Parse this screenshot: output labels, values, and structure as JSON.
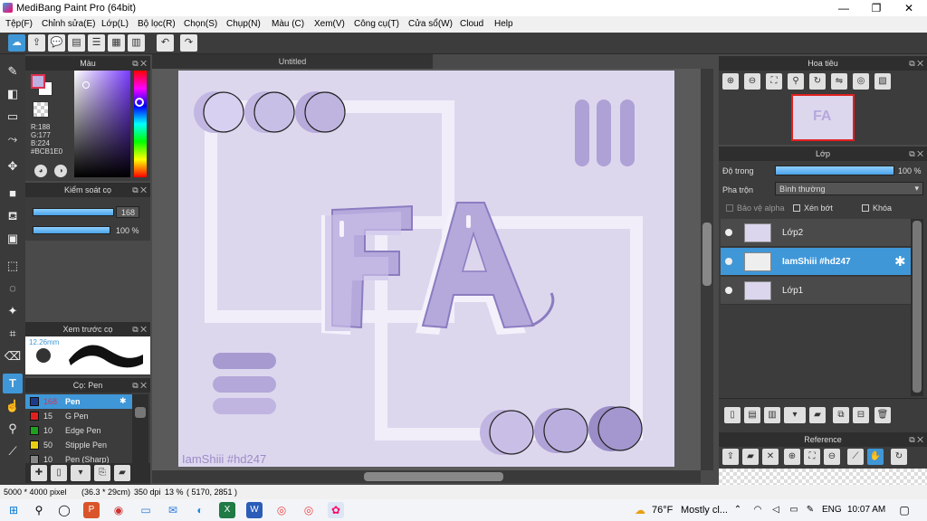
{
  "window": {
    "title": "MediBang Paint Pro (64bit)",
    "minimize": "—",
    "maximize": "❐",
    "close": "✕"
  },
  "menu": [
    "Tệp(F)",
    "Chỉnh sửa(E)",
    "Lớp(L)",
    "Bộ lọc(R)",
    "Chọn(S)",
    "Chụp(N)",
    "Màu (C)",
    "Xem(V)",
    "Công cụ(T)",
    "Cửa sổ(W)",
    "Cloud",
    "Help"
  ],
  "color_panel": {
    "title": "Màu",
    "r": "R:188",
    "g": "G:177",
    "b": "B:224",
    "hex": "#BCB1E0",
    "fg_color": "#bcb1e0"
  },
  "brush_control": {
    "title": "Kiểm soát cọ",
    "size_value": "168",
    "opacity_value": "100 %"
  },
  "brush_preview": {
    "title": "Xem trước cọ",
    "size_label": "12.26mm"
  },
  "brush_list": {
    "title": "Cọ: Pen",
    "items": [
      {
        "size": "168",
        "name": "Pen",
        "color": "#1e3a8a"
      },
      {
        "size": "15",
        "name": "G Pen",
        "color": "#e02020"
      },
      {
        "size": "10",
        "name": "Edge Pen",
        "color": "#20a020"
      },
      {
        "size": "50",
        "name": "Stipple Pen",
        "color": "#e8d010"
      },
      {
        "size": "10",
        "name": "Pen (Sharp)",
        "color": "#888888"
      }
    ]
  },
  "canvas": {
    "tab_title": "Untitled",
    "watermark": "IamShiii #hd247",
    "art_text": "FA"
  },
  "navigator": {
    "title": "Hoa tiêu"
  },
  "layers": {
    "title": "Lớp",
    "opacity_label": "Độ trong",
    "opacity_value": "100 %",
    "blend_label": "Pha trộn",
    "blend_value": "Bình thường",
    "protect_alpha": "Bảo vệ alpha",
    "clipping": "Xén bớt",
    "lock": "Khóa",
    "items": [
      {
        "name": "Lớp2",
        "selected": false
      },
      {
        "name": "IamShiii #hd247",
        "selected": true
      },
      {
        "name": "Lớp1",
        "selected": false
      }
    ]
  },
  "reference": {
    "title": "Reference"
  },
  "status": {
    "size": "5000 * 4000 pixel",
    "cm": "(36.3 * 29cm)",
    "dpi": "350 dpi",
    "zoom": "13 %",
    "coords": "( 5170, 2851 )"
  },
  "taskbar": {
    "weather_temp": "76°F",
    "weather_text": "Mostly cl...",
    "lang": "ENG",
    "time": "10:07 AM"
  },
  "colors": {
    "accent": "#3f97d8",
    "canvas_bg": "#ddd7ee",
    "lilac": "#b9aedb",
    "purple_dark": "#9a8cc6"
  }
}
